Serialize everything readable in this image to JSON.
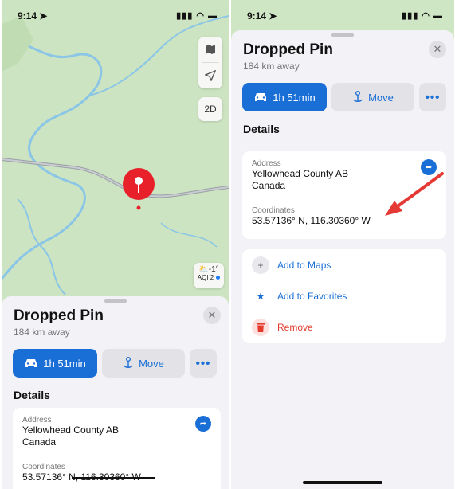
{
  "status": {
    "time": "9:14 ➤",
    "icons": "▮▮▮ ◠ ▬"
  },
  "map": {
    "btn_2d": "2D",
    "weather_temp": "⛅-1°",
    "weather_aqi": "AQI 2"
  },
  "sheet": {
    "title": "Dropped Pin",
    "subtitle": "184 km away",
    "directions_label": "1h 51min",
    "move_label": "Move",
    "more_label": "•••",
    "details_heading": "Details",
    "address_label": "Address",
    "address_line1": "Yellowhead County AB",
    "address_line2": "Canada",
    "coordinates_label": "Coordinates",
    "coordinates_value": "53.57136° N, 116.30360° W"
  },
  "actions_list": [
    {
      "label": "Add to Maps"
    },
    {
      "label": "Add to Favorites"
    },
    {
      "label": "Remove"
    }
  ],
  "colors": {
    "accent": "#1a6fd6",
    "pin": "#e8202a",
    "danger": "#e33a2c",
    "arrow": "#e53935"
  },
  "icons": [
    "map-icon",
    "location-arrow-icon",
    "car-icon",
    "move-pin-icon",
    "share-icon",
    "close-icon",
    "plus-icon",
    "star-icon",
    "trash-icon",
    "signal-icon",
    "wifi-icon",
    "battery-icon"
  ]
}
